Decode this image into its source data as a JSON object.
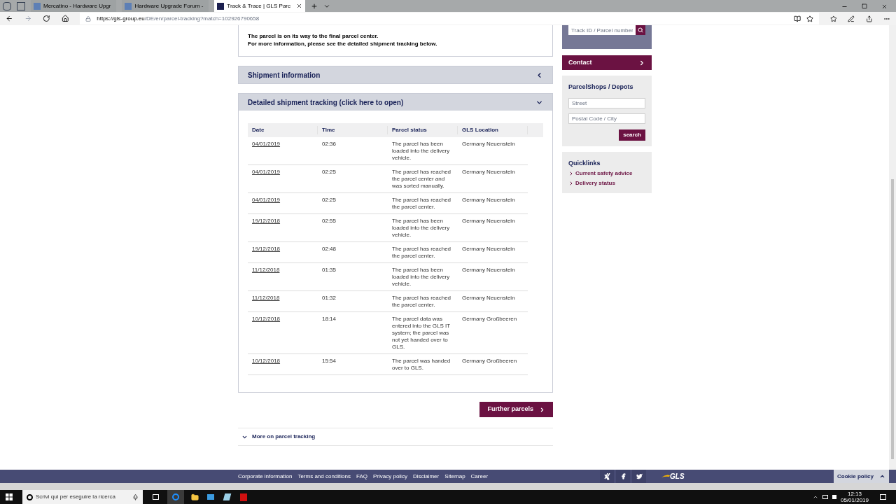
{
  "browser": {
    "tabs": [
      {
        "title": "Mercatino - Hardware Upgr",
        "selected": false
      },
      {
        "title": "Hardware Upgrade Forum -",
        "selected": false
      },
      {
        "title": "Track & Trace | GLS Parc",
        "selected": true
      }
    ],
    "url": {
      "host": "https://gls-group.eu",
      "path": "/DE/en/parcel-tracking?match=102926790658"
    }
  },
  "status_message": [
    "The parcel is on its way to the final parcel center.",
    "For more information, please see the detailed shipment tracking below."
  ],
  "sections": [
    {
      "title": "Shipment information",
      "expanded": false
    },
    {
      "title": "Detailed shipment tracking (click here to open)",
      "expanded": true
    }
  ],
  "table": {
    "columns": [
      "Date",
      "Time",
      "Parcel status",
      "GLS Location"
    ],
    "rows": [
      [
        "04/01/2019",
        "02:36",
        "The parcel has been loaded into the delivery vehicle.",
        "Germany Neuenstein"
      ],
      [
        "04/01/2019",
        "02:25",
        "The parcel has reached the parcel center and was sorted manually.",
        "Germany Neuenstein"
      ],
      [
        "04/01/2019",
        "02:25",
        "The parcel has reached the parcel center.",
        "Germany Neuenstein"
      ],
      [
        "19/12/2018",
        "02:55",
        "The parcel has been loaded into the delivery vehicle.",
        "Germany Neuenstein"
      ],
      [
        "19/12/2018",
        "02:48",
        "The parcel has reached the parcel center.",
        "Germany Neuenstein"
      ],
      [
        "11/12/2018",
        "01:35",
        "The parcel has been loaded into the delivery vehicle.",
        "Germany Neuenstein"
      ],
      [
        "11/12/2018",
        "01:32",
        "The parcel has reached the parcel center.",
        "Germany Neuenstein"
      ],
      [
        "10/12/2018",
        "18:14",
        "The parcel data was entered into the GLS IT system; the parcel was not yet handed over to GLS.",
        "Germany Großbeeren"
      ],
      [
        "10/12/2018",
        "15:54",
        "The parcel was handed over to GLS.",
        "Germany Großbeeren"
      ]
    ]
  },
  "further_button": "Further parcels",
  "more_link": "More on parcel tracking",
  "sidebar": {
    "track_placeholder": "Track ID / Parcel number",
    "contact": "Contact",
    "parcelshops": {
      "title": "ParcelShops / Depots",
      "street_placeholder": "Street",
      "city_placeholder": "Postal Code / City",
      "button": "search"
    },
    "quicklinks": {
      "title": "Quicklinks",
      "links": [
        "Current safety advice",
        "Delivery status"
      ]
    }
  },
  "footer": {
    "links": [
      "Corporate information",
      "Terms and conditions",
      "FAQ",
      "Privacy policy",
      "Disclaimer",
      "Sitemap",
      "Career"
    ],
    "logo": "GLS",
    "cookie": "Cookie policy"
  },
  "taskbar": {
    "search_placeholder": "Scrivi qui per eseguire la ricerca",
    "time": "12:13",
    "date": "05/01/2019"
  }
}
